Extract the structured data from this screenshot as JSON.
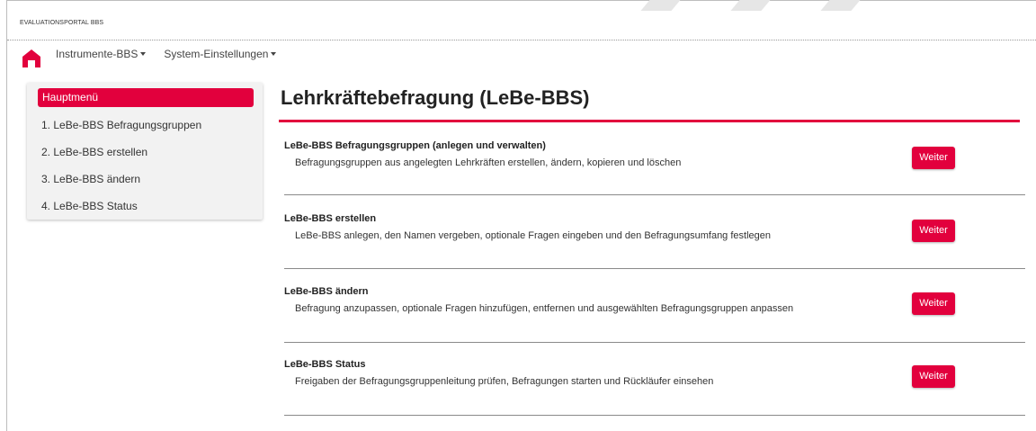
{
  "portal": {
    "title": "EVALUATIONSPORTAL BBS"
  },
  "nav": {
    "items": [
      "Instrumente-BBS",
      "System-Einstellungen"
    ]
  },
  "sidebar": {
    "header": "Hauptmenü",
    "items": [
      "1. LeBe-BBS Befragungsgruppen",
      "2. LeBe-BBS erstellen",
      "3. LeBe-BBS ändern",
      "4. LeBe-BBS Status"
    ]
  },
  "main": {
    "title": "Lehrkräftebefragung (LeBe-BBS)",
    "sections": [
      {
        "title": "LeBe-BBS Befragungsgruppen (anlegen und verwalten)",
        "description": "Befragungsgruppen aus angelegten Lehrkräften erstellen, ändern, kopieren und löschen",
        "button": "Weiter"
      },
      {
        "title": "LeBe-BBS erstellen",
        "description": "LeBe-BBS anlegen, den Namen vergeben, optionale Fragen eingeben und den Befragungsumfang festlegen",
        "button": "Weiter"
      },
      {
        "title": "LeBe-BBS ändern",
        "description": "Befragung anzupassen, optionale Fragen hinzufügen, entfernen und ausgewählten Befragungsgruppen anpassen",
        "button": "Weiter"
      },
      {
        "title": "LeBe-BBS Status",
        "description": "Freigaben der Befragungsgruppenleitung prüfen, Befragungen starten und Rückläufer einsehen",
        "button": "Weiter"
      }
    ]
  },
  "colors": {
    "accent": "#e2003d",
    "rule": "#8a8a8a",
    "sidebar_bg": "#f2f2f2"
  }
}
